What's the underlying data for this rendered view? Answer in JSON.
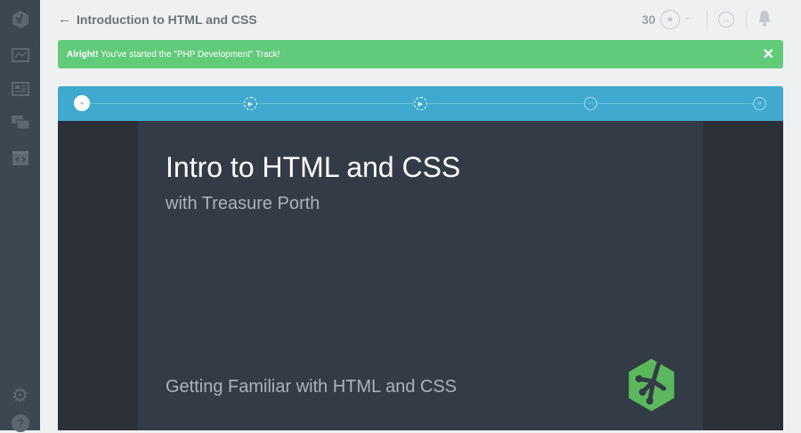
{
  "header": {
    "title": "Introduction to HTML and CSS",
    "points": "30"
  },
  "banner": {
    "strong": "Alright!",
    "message": " You've started the \"PHP Development\" Track!",
    "close": "✕"
  },
  "video": {
    "title": "Intro to HTML and CSS",
    "subtitle": "with Treasure Porth",
    "caption": "Getting Familiar with HTML and CSS"
  },
  "colors": {
    "sidebar": "#3d4751",
    "banner": "#62cb7a",
    "track": "#40a9cf",
    "logo": "#5cb85c"
  }
}
